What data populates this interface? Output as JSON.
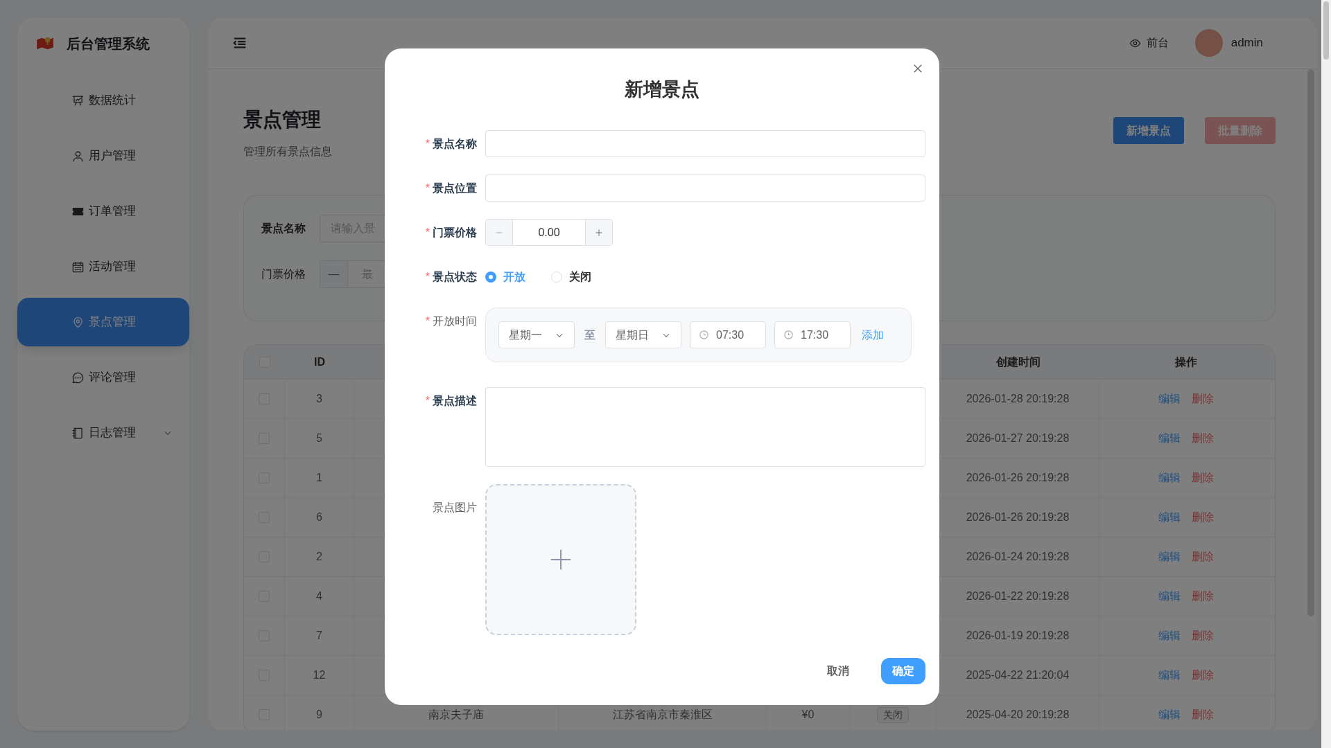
{
  "sidebar": {
    "brand": "后台管理系统",
    "items": [
      {
        "label": "数据统计",
        "selected": false
      },
      {
        "label": "用户管理",
        "selected": false
      },
      {
        "label": "订单管理",
        "selected": false
      },
      {
        "label": "活动管理",
        "selected": false
      },
      {
        "label": "景点管理",
        "selected": true
      },
      {
        "label": "评论管理",
        "selected": false
      },
      {
        "label": "日志管理",
        "selected": false,
        "expandable": true
      }
    ]
  },
  "header": {
    "frontend_link": "前台",
    "user": "admin"
  },
  "page": {
    "title": "景点管理",
    "subtitle": "管理所有景点信息",
    "buttons": [
      {
        "label": "新增景点",
        "kind": "primary"
      },
      {
        "label": "批量删除",
        "kind": "danger"
      }
    ]
  },
  "filters": {
    "name_label": "景点名称",
    "name_placeholder": "请输入景",
    "price_label": "门票价格",
    "price_minus": "—",
    "price_placeholder": "最"
  },
  "table": {
    "header_checked": false,
    "columns": [
      {
        "label": "ID"
      },
      {
        "label": "创建时间"
      },
      {
        "label": "操作"
      }
    ],
    "rows": [
      {
        "id": "3",
        "created": "2026-01-28 20:19:28",
        "checked": false,
        "actions": [
          "编辑",
          "删除"
        ]
      },
      {
        "id": "5",
        "created": "2026-01-27 20:19:28",
        "checked": false,
        "actions": [
          "编辑",
          "删除"
        ]
      },
      {
        "id": "1",
        "created": "2026-01-26 20:19:28",
        "checked": false,
        "actions": [
          "编辑",
          "删除"
        ]
      },
      {
        "id": "6",
        "created": "2026-01-26 20:19:28",
        "checked": false,
        "actions": [
          "编辑",
          "删除"
        ]
      },
      {
        "id": "2",
        "created": "2026-01-24 20:19:28",
        "checked": false,
        "actions": [
          "编辑",
          "删除"
        ]
      },
      {
        "id": "4",
        "created": "2026-01-22 20:19:28",
        "checked": false,
        "actions": [
          "编辑",
          "删除"
        ]
      },
      {
        "id": "7",
        "created": "2026-01-19 20:19:28",
        "checked": false,
        "actions": [
          "编辑",
          "删除"
        ]
      },
      {
        "id": "12",
        "created": "2025-04-22 21:20:04",
        "checked": false,
        "actions": [
          "编辑",
          "删除"
        ]
      },
      {
        "id": "9",
        "name": "南京夫子庙",
        "location": "江苏省南京市秦淮区",
        "price": "¥0",
        "status": "关闭",
        "created": "2025-04-20 20:19:28",
        "checked": false,
        "actions": [
          "编辑",
          "删除"
        ]
      }
    ]
  },
  "dialog": {
    "title": "新增景点",
    "required_mark": "*",
    "fields": [
      {
        "label": "景点名称",
        "required": true,
        "kind": "text"
      },
      {
        "label": "景点位置",
        "required": true,
        "kind": "text"
      },
      {
        "label": "门票价格",
        "required": true,
        "kind": "number",
        "value": "0.00"
      },
      {
        "label": "景点状态",
        "required": true,
        "kind": "radio",
        "options": [
          {
            "label": "开放",
            "selected": true
          },
          {
            "label": "关闭",
            "selected": false
          }
        ]
      },
      {
        "label": "开放时间",
        "required": true,
        "kind": "schedule",
        "from_day": "星期一",
        "separator": "至",
        "to_day": "星期日",
        "start": "07:30",
        "end": "17:30",
        "add": "添加"
      },
      {
        "label": "景点描述",
        "required": true,
        "kind": "textarea"
      },
      {
        "label": "景点图片",
        "required": false,
        "kind": "upload"
      }
    ],
    "buttons": [
      {
        "label": "取消",
        "kind": "text"
      },
      {
        "label": "确定",
        "kind": "primary"
      }
    ]
  }
}
